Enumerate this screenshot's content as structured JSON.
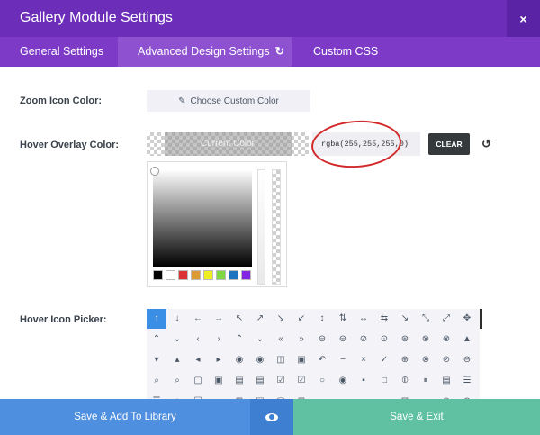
{
  "header": {
    "title": "Gallery Module Settings",
    "close_glyph": "×",
    "close_icon": "close-icon"
  },
  "tabs": [
    {
      "label": "General Settings",
      "active": false
    },
    {
      "label": "Advanced Design Settings",
      "active": true,
      "icon": "reset-icon"
    },
    {
      "label": "Custom CSS",
      "active": false
    }
  ],
  "zoom": {
    "label": "Zoom Icon Color:",
    "button": "Choose Custom Color",
    "icon": "eyedropper-icon"
  },
  "hover": {
    "label": "Hover Overlay Color:",
    "current": "Current Color",
    "value": "rgba(255,255,255,0)",
    "clear": "CLEAR",
    "undo_icon": "undo-icon"
  },
  "picker": {
    "palette": [
      "#000000",
      "#ffffff",
      "#dd3333",
      "#dd9933",
      "#eeee22",
      "#81d742",
      "#1e73be",
      "#8224e3"
    ]
  },
  "icon_picker": {
    "label": "Hover Icon Picker:",
    "rows": [
      [
        "↑",
        "↓",
        "←",
        "→",
        "↖",
        "↗",
        "↘",
        "↙",
        "↕",
        "⇅",
        "↔",
        "⇆",
        "↘",
        "⤡",
        "⤢",
        "✥"
      ],
      [
        "⌃",
        "⌄",
        "‹",
        "›",
        "⌃",
        "⌄",
        "«",
        "»",
        "⊖",
        "⊖",
        "⊘",
        "⊙",
        "⊛",
        "⊗",
        "⊗",
        "▲"
      ],
      [
        "▾",
        "▴",
        "◂",
        "▸",
        "◉",
        "◉",
        "◫",
        "▣",
        "↶",
        "−",
        "×",
        "✓",
        "⊕",
        "⊗",
        "⊘",
        "⊖"
      ],
      [
        "⌕",
        "⌕",
        "▢",
        "▣",
        "▤",
        "▤",
        "☑",
        "☑",
        "○",
        "◉",
        "▪",
        "□",
        "⦶",
        "⏸",
        "▤",
        "☰"
      ],
      [
        "☰",
        "⌂",
        "☐",
        "▭",
        "⊞",
        "▤",
        "▢",
        "⊞",
        "▭",
        "▭",
        "▬",
        "▭",
        "⊡",
        "▭",
        "⊜",
        "⊛"
      ]
    ],
    "selected": "↑"
  },
  "footer": {
    "save_library": "Save & Add To Library",
    "preview_icon": "eye-icon",
    "save_exit": "Save & Exit"
  },
  "colors": {
    "header": "#6c2eb9",
    "tabs": "#7d3ac7",
    "active_tab": "#8e52d0",
    "blue": "#4f8fe0",
    "green": "#5fc1a2",
    "highlight_ring": "#d12a2a"
  }
}
